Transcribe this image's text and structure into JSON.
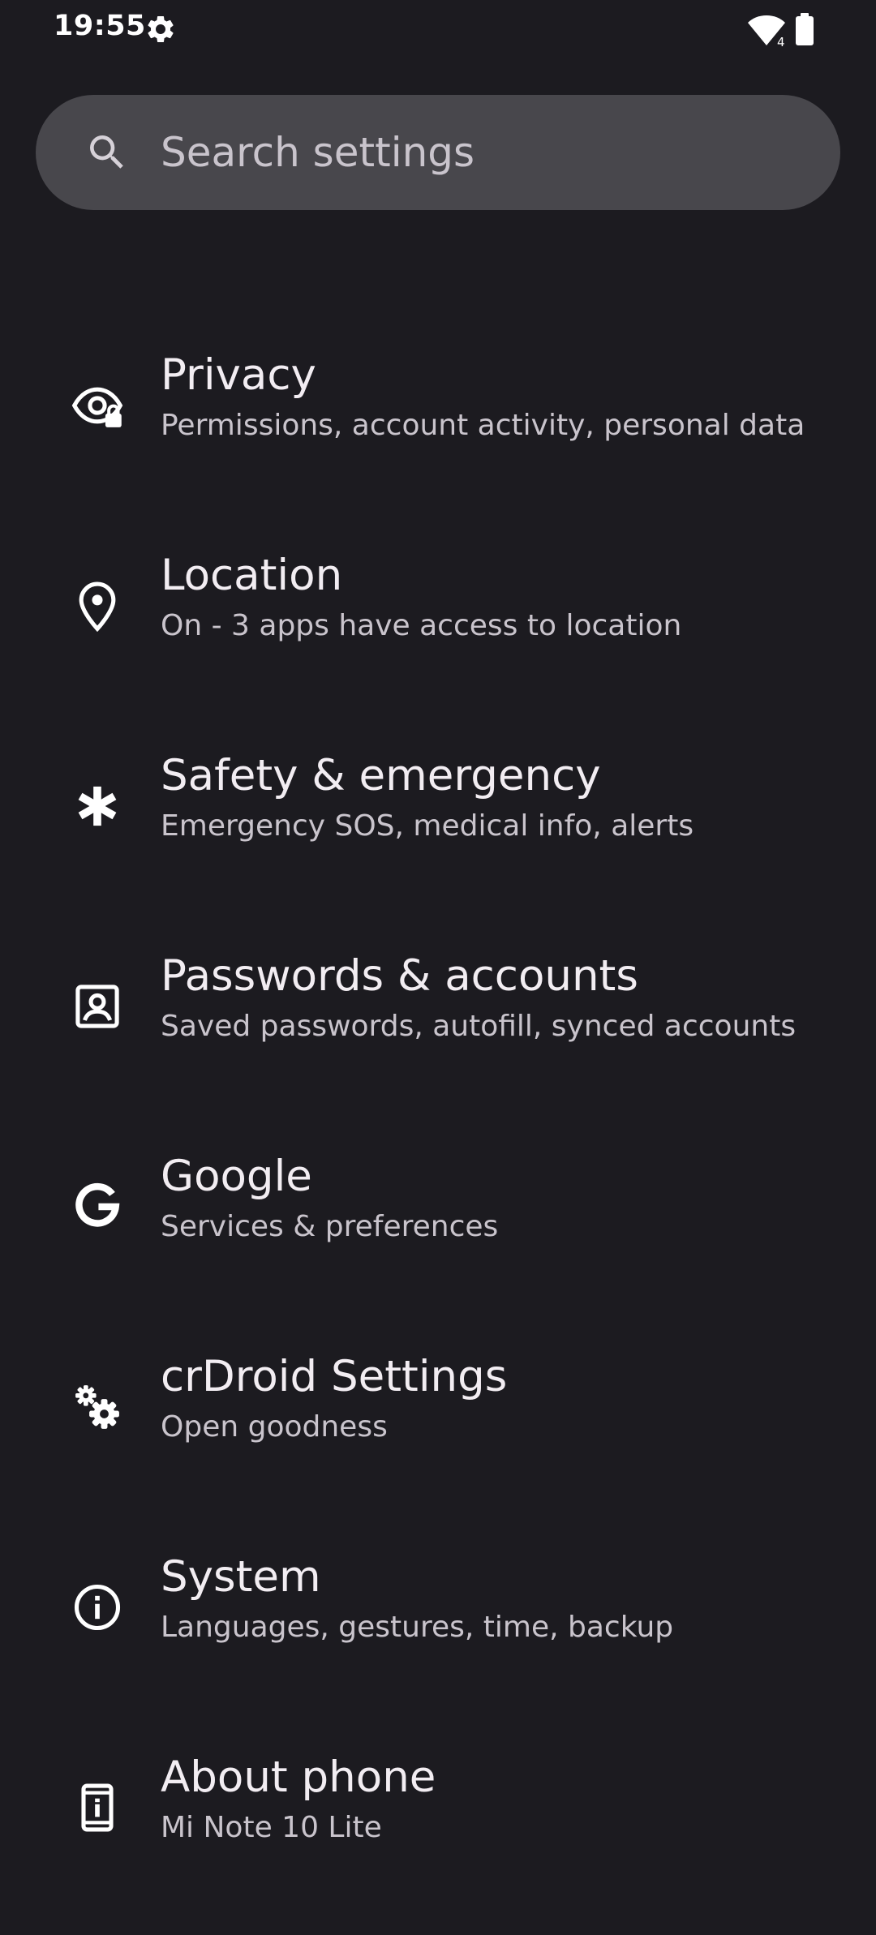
{
  "status_bar": {
    "time": "19:55",
    "wifi_badge": "4",
    "icons": [
      "gear-icon",
      "wifi-icon",
      "battery-icon"
    ]
  },
  "search": {
    "placeholder": "Search settings"
  },
  "settings": [
    {
      "title": "Privacy",
      "subtitle": "Permissions, account activity, personal data",
      "icon": "eye-lock-icon"
    },
    {
      "title": "Location",
      "subtitle": "On - 3 apps have access to location",
      "icon": "location-pin-icon"
    },
    {
      "title": "Safety & emergency",
      "subtitle": "Emergency SOS, medical info, alerts",
      "icon": "asterisk-icon"
    },
    {
      "title": "Passwords & accounts",
      "subtitle": "Saved passwords, autofill, synced accounts",
      "icon": "account-box-icon"
    },
    {
      "title": "Google",
      "subtitle": "Services & preferences",
      "icon": "google-icon"
    },
    {
      "title": "crDroid Settings",
      "subtitle": "Open goodness",
      "icon": "gears-icon"
    },
    {
      "title": "System",
      "subtitle": "Languages, gestures, time, backup",
      "icon": "info-icon"
    },
    {
      "title": "About phone",
      "subtitle": "Mi Note 10 Lite",
      "icon": "phone-info-icon"
    }
  ],
  "colors": {
    "background": "#1c1b20",
    "search_background": "#48474c",
    "title_text": "#f2edf2",
    "subtitle_text": "#c9c4cc"
  }
}
